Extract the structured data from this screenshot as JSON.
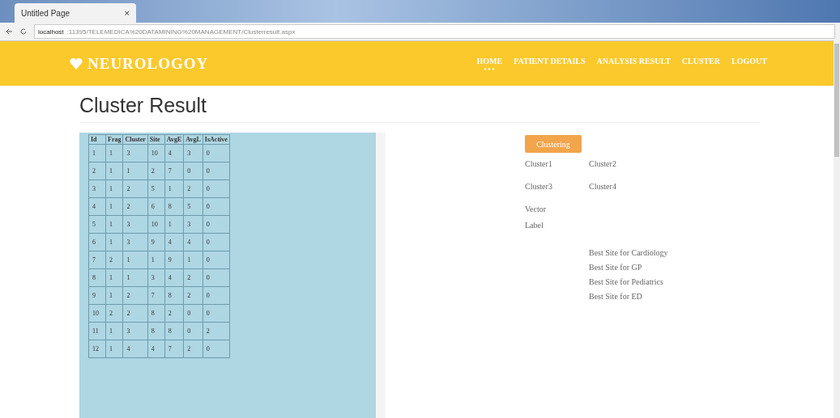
{
  "browser": {
    "tab_title": "Untitled Page",
    "tab_close": "×",
    "url_host": "localhost",
    "url_path": ":11395/TELEMEDICA%20DATAMINING%20MANAGEMENT/Clusterresult.aspx"
  },
  "navbar": {
    "logo": "NEUROLOGOY",
    "links": [
      {
        "label": "HOME",
        "selected": true
      },
      {
        "label": "PATIENT DETAILS",
        "selected": false
      },
      {
        "label": "ANALYSIS RESULT",
        "selected": false
      },
      {
        "label": "CLUSTER",
        "selected": false
      },
      {
        "label": "LOGOUT",
        "selected": false
      }
    ]
  },
  "page_title": "Cluster Result",
  "table": {
    "columns": [
      "Id",
      "Frag",
      "Cluster",
      "Site",
      "AvgE",
      "AvgL",
      "IsActive"
    ],
    "rows": [
      [
        "1",
        "1",
        "3",
        "10",
        "4",
        "3",
        "0"
      ],
      [
        "2",
        "1",
        "1",
        "2",
        "7",
        "0",
        "0"
      ],
      [
        "3",
        "1",
        "2",
        "5",
        "1",
        "2",
        "0"
      ],
      [
        "4",
        "1",
        "2",
        "6",
        "8",
        "5",
        "0"
      ],
      [
        "5",
        "1",
        "3",
        "10",
        "1",
        "3",
        "0"
      ],
      [
        "6",
        "1",
        "3",
        "9",
        "4",
        "4",
        "0"
      ],
      [
        "7",
        "2",
        "1",
        "1",
        "9",
        "1",
        "0"
      ],
      [
        "8",
        "1",
        "1",
        "3",
        "4",
        "2",
        "0"
      ],
      [
        "9",
        "1",
        "2",
        "7",
        "8",
        "2",
        "0"
      ],
      [
        "10",
        "2",
        "2",
        "8",
        "2",
        "0",
        "0"
      ],
      [
        "11",
        "1",
        "3",
        "8",
        "8",
        "0",
        "2"
      ],
      [
        "12",
        "1",
        "4",
        "4",
        "7",
        "2",
        "0"
      ]
    ]
  },
  "clustering_button": "Clustering",
  "clusters": [
    [
      "Cluster1",
      "Cluster2"
    ],
    [
      "Cluster3",
      "Cluster4"
    ]
  ],
  "labels": [
    "Vector",
    "Label"
  ],
  "best_sites": [
    "Best Site for Cardiology",
    "Best Site for GP",
    "Best Site for Pediatrics",
    "Best Site for ED"
  ]
}
